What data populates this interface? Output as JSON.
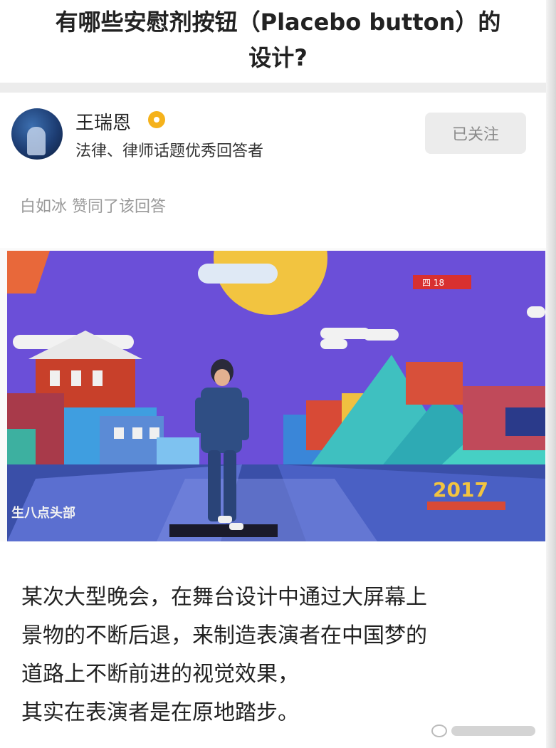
{
  "question": {
    "title_line1": "有哪些安慰剂按钮（Placebo button）的",
    "title_line2": "设计?"
  },
  "author": {
    "name": "王瑞恩",
    "description": "法律、律师话题优秀回答者",
    "follow_button": "已关注",
    "badge_color": "#f5b21b"
  },
  "activity": {
    "liked_text": "白如冰 赞同了该回答"
  },
  "video": {
    "caption": "生八点头部",
    "year": "2017",
    "badge": "四 18"
  },
  "answer": {
    "lines": [
      "某次大型晚会，在舞台设计中通过大屏幕上",
      "景物的不断后退，来制造表演者在中国梦的",
      "道路上不断前进的视觉效果，",
      "其实在表演者是在原地踏步。"
    ]
  },
  "colors": {
    "accent_gray": "#ececec",
    "sky": "#6b4fd8",
    "moon": "#f2c440"
  }
}
